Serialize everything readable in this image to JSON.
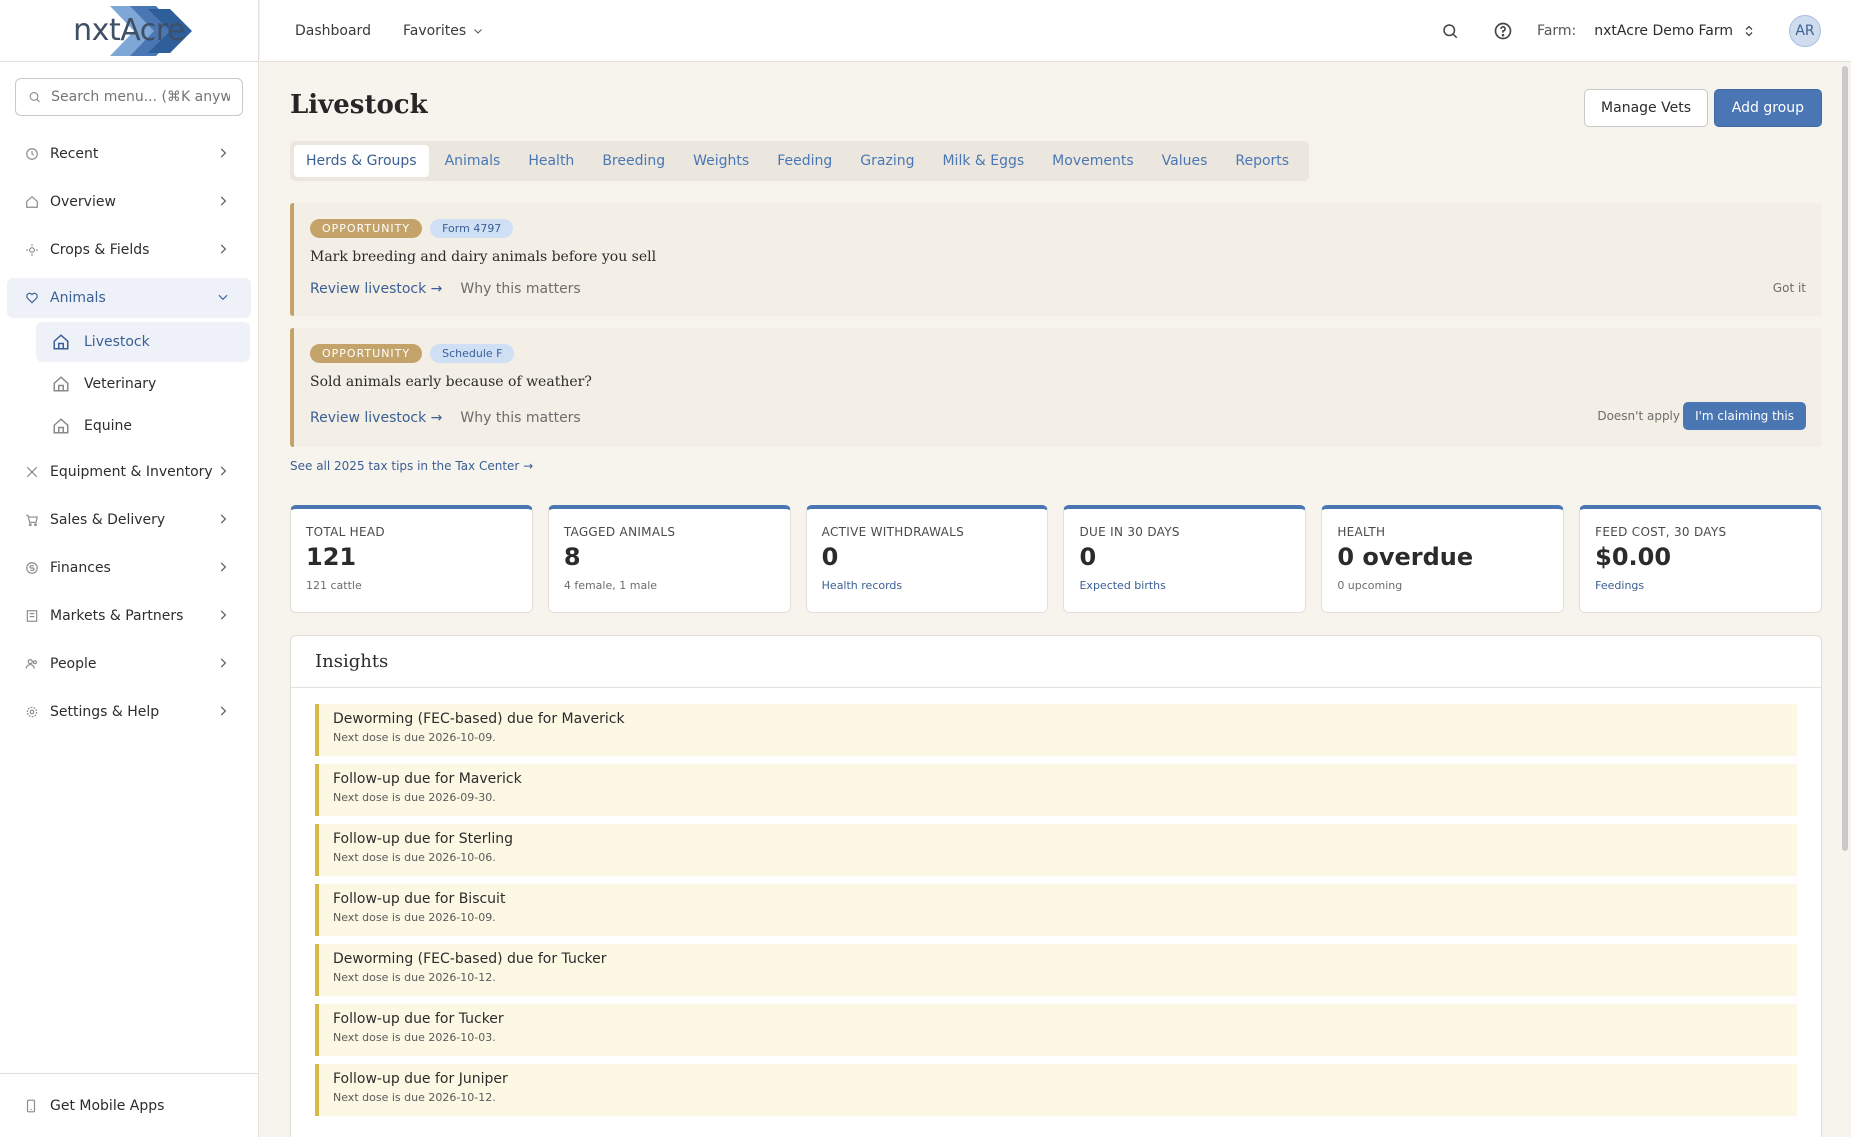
{
  "brand": {
    "logo_text": "nxtAcre"
  },
  "sidebar": {
    "search_placeholder": "Search menu... (⌘K anywhere)",
    "items": [
      {
        "label": "Recent",
        "icon": "clock-icon"
      },
      {
        "label": "Overview",
        "icon": "home-icon"
      },
      {
        "label": "Crops & Fields",
        "icon": "sun-icon"
      },
      {
        "label": "Animals",
        "icon": "heart-icon"
      },
      {
        "label": "Equipment & Inventory",
        "icon": "tools-icon"
      },
      {
        "label": "Sales & Delivery",
        "icon": "cart-icon"
      },
      {
        "label": "Finances",
        "icon": "dollar-icon"
      },
      {
        "label": "Markets & Partners",
        "icon": "building-icon"
      },
      {
        "label": "People",
        "icon": "people-icon"
      },
      {
        "label": "Settings & Help",
        "icon": "gear-icon"
      }
    ],
    "animals_sub": [
      {
        "label": "Livestock"
      },
      {
        "label": "Veterinary"
      },
      {
        "label": "Equine"
      }
    ],
    "mobile_label": "Get Mobile Apps"
  },
  "topbar": {
    "dashboard": "Dashboard",
    "favorites": "Favorites",
    "farm_label": "Farm:",
    "farm_name": "nxtAcre Demo Farm",
    "avatar": "AR"
  },
  "page": {
    "title": "Livestock",
    "manage_vets": "Manage Vets",
    "add_group": "Add group",
    "tabs": [
      "Herds & Groups",
      "Animals",
      "Health",
      "Breeding",
      "Weights",
      "Feeding",
      "Grazing",
      "Milk & Eggs",
      "Movements",
      "Values",
      "Reports"
    ]
  },
  "opportunities": [
    {
      "badge": "OPPORTUNITY",
      "tag": "Form 4797",
      "title": "Mark breeding and dairy animals before you sell",
      "review": "Review livestock →",
      "why": "Why this matters",
      "dismiss": "Got it"
    },
    {
      "badge": "OPPORTUNITY",
      "tag": "Schedule F",
      "title": "Sold animals early because of weather?",
      "review": "Review livestock →",
      "why": "Why this matters",
      "doesnt_apply": "Doesn't apply",
      "claim": "I'm claiming this"
    }
  ],
  "tax_link": "See all 2025 tax tips in the Tax Center →",
  "stats": [
    {
      "label": "TOTAL HEAD",
      "value": "121",
      "sub": "121 cattle",
      "sub_link": false
    },
    {
      "label": "TAGGED ANIMALS",
      "value": "8",
      "sub": "4 female, 1 male",
      "sub_link": false
    },
    {
      "label": "ACTIVE WITHDRAWALS",
      "value": "0",
      "sub": "Health records",
      "sub_link": true
    },
    {
      "label": "DUE IN 30 DAYS",
      "value": "0",
      "sub": "Expected births",
      "sub_link": true
    },
    {
      "label": "HEALTH",
      "value": "0 overdue",
      "sub": "0 upcoming",
      "sub_link": false
    },
    {
      "label": "FEED COST, 30 DAYS",
      "value": "$0.00",
      "sub": "Feedings",
      "sub_link": true
    }
  ],
  "insights": {
    "title": "Insights",
    "items": [
      {
        "title": "Deworming (FEC-based) due for Maverick",
        "sub": "Next dose is due 2026-10-09."
      },
      {
        "title": "Follow-up due for Maverick",
        "sub": "Next dose is due 2026-09-30."
      },
      {
        "title": "Follow-up due for Sterling",
        "sub": "Next dose is due 2026-10-06."
      },
      {
        "title": "Follow-up due for Biscuit",
        "sub": "Next dose is due 2026-10-09."
      },
      {
        "title": "Deworming (FEC-based) due for Tucker",
        "sub": "Next dose is due 2026-10-12."
      },
      {
        "title": "Follow-up due for Tucker",
        "sub": "Next dose is due 2026-10-03."
      },
      {
        "title": "Follow-up due for Juniper",
        "sub": "Next dose is due 2026-10-12."
      }
    ]
  },
  "colors": {
    "accent": "#4a77b4",
    "opportunity": "#c4a36a",
    "insight_border": "#d7b94a"
  }
}
